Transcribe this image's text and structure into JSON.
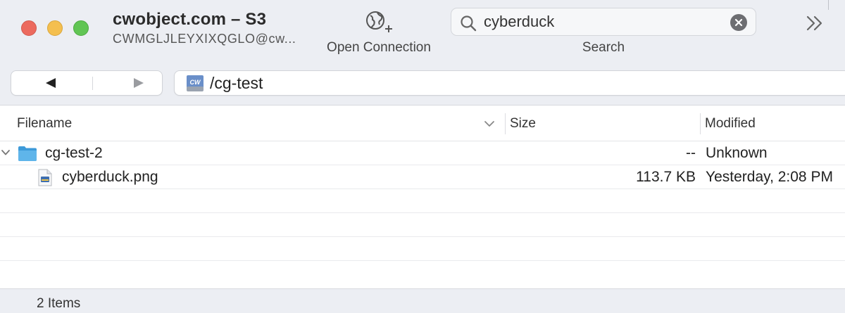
{
  "window": {
    "title": "cwobject.com – S3",
    "subtitle": "CWMGLJLEYXIXQGLO@cw..."
  },
  "toolbar": {
    "open_connection_label": "Open Connection",
    "open_connection_icon": "globe-plus-icon",
    "search_label": "Search",
    "search_value": "cyberduck",
    "more_icon": "chevrons-right-icon"
  },
  "navigation": {
    "back_icon": "triangle-left-icon",
    "forward_icon": "triangle-right-icon"
  },
  "path": {
    "drive_icon": "cw-drive-icon",
    "value": "/cg-test"
  },
  "columns": {
    "filename": "Filename",
    "size": "Size",
    "modified": "Modified"
  },
  "rows": [
    {
      "name": "cg-test-2",
      "size": "--",
      "modified": "Unknown",
      "type": "folder",
      "icon": "folder-icon",
      "expanded": true
    },
    {
      "name": "cyberduck.png",
      "size": "113.7 KB",
      "modified": "Yesterday, 2:08 PM",
      "type": "file",
      "icon": "image-file-icon"
    }
  ],
  "status": {
    "item_count": "2 Items"
  },
  "colors": {
    "close": "#ec6a5e",
    "minimize": "#f4bf4f",
    "maximize": "#61c554",
    "folder": "#4ea8e0",
    "toolbar_bg": "#eceef3"
  }
}
